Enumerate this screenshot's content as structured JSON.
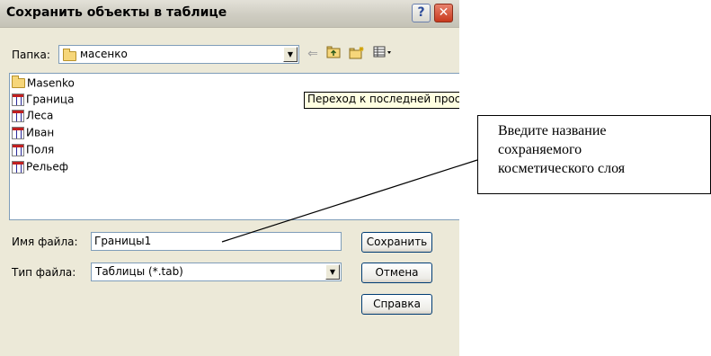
{
  "dialog": {
    "title": "Сохранить объекты в таблице",
    "help_label": "?",
    "close_label": "✕"
  },
  "folder": {
    "label": "Папка:",
    "value": "масенко"
  },
  "toolbar": {
    "back_icon": "back-arrow-icon",
    "up_icon": "up-folder-icon",
    "new_folder_icon": "new-folder-icon",
    "view_icon": "view-menu-icon"
  },
  "file_list": {
    "items": [
      {
        "name": "Masenko",
        "icon": "folder-icon"
      },
      {
        "name": "Граница",
        "icon": "table-icon"
      },
      {
        "name": "Леса",
        "icon": "table-icon"
      },
      {
        "name": "Иван",
        "icon": "table-icon"
      },
      {
        "name": "Поля",
        "icon": "table-icon"
      },
      {
        "name": "Рельеф",
        "icon": "table-icon"
      }
    ],
    "tooltip": "Переход к последней просм"
  },
  "filename": {
    "label": "Имя файла:",
    "value": "Границы1"
  },
  "filetype": {
    "label": "Тип файла:",
    "value": "Таблицы (*.tab)"
  },
  "buttons": {
    "save": "Сохранить",
    "cancel": "Отмена",
    "help": "Справка"
  },
  "callout": {
    "lines": [
      "Введите название",
      "сохраняемого",
      "косметического слоя"
    ]
  }
}
